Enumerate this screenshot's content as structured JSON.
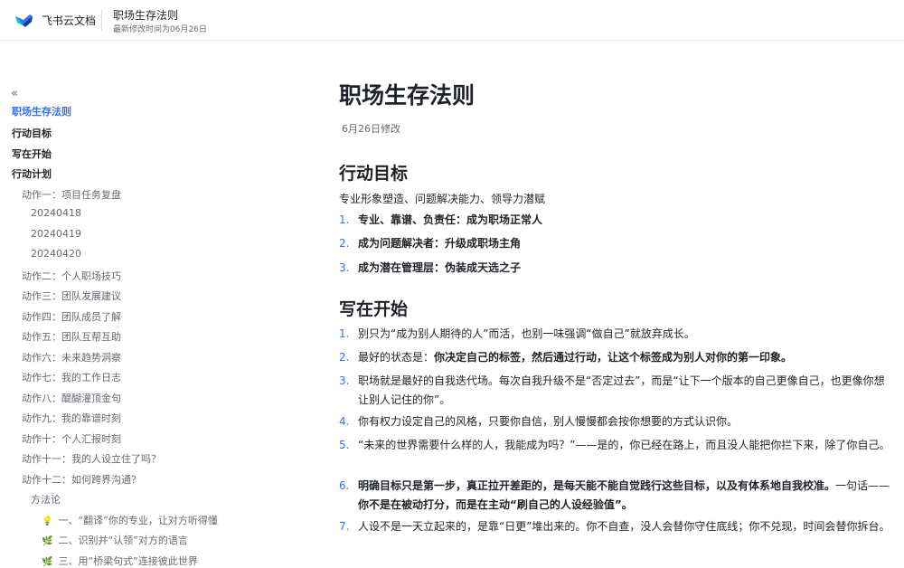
{
  "header": {
    "brand": "飞书云文档",
    "doc_title": "职场生存法则",
    "last_modified": "最新修改时间为06月26日"
  },
  "toc": {
    "collapse_icon": "«",
    "items": [
      {
        "label": "职场生存法则"
      },
      {
        "label": "行动目标"
      },
      {
        "label": "写在开始"
      },
      {
        "label": "行动计划"
      },
      {
        "label": "动作一：项目任务复盘"
      },
      {
        "label": "20240418"
      },
      {
        "label": "20240419"
      },
      {
        "label": "20240420"
      },
      {
        "label": "动作二：个人职场技巧"
      },
      {
        "label": "动作三：团队发展建议"
      },
      {
        "label": "动作四：团队成员了解"
      },
      {
        "label": "动作五：团队互帮互助"
      },
      {
        "label": "动作六：未来趋势洞察"
      },
      {
        "label": "动作七：我的工作日志"
      },
      {
        "label": "动作八：醍醐灌顶金句"
      },
      {
        "label": "动作九：我的靠谱时刻"
      },
      {
        "label": "动作十：个人汇报时刻"
      },
      {
        "label": "动作十一：我的人设立住了吗？"
      },
      {
        "label": "动作十二：如何跨界沟通？"
      },
      {
        "label": "方法论"
      },
      {
        "label": "一、“翻译”你的专业，让对方听得懂",
        "emoji": "💡"
      },
      {
        "label": "二、识别并“认领”对方的语言",
        "emoji": "🌿"
      },
      {
        "label": "三、用“桥梁句式”连接彼此世界",
        "emoji": "🌿"
      }
    ]
  },
  "doc": {
    "title": "职场生存法则",
    "modified": "6月26日修改",
    "sections": [
      {
        "heading": "行动目标",
        "intro": "专业形象塑造、问题解决能力、领导力潜赋",
        "items": [
          {
            "num": "1.",
            "bold": "专业、靠谱、负责任：成为职场正常人"
          },
          {
            "num": "2.",
            "bold": "成为问题解决者：升级成职场主角"
          },
          {
            "num": "3.",
            "bold": "成为潜在管理层：伪装成天选之子"
          }
        ]
      },
      {
        "heading": "写在开始",
        "items": [
          {
            "num": "1.",
            "pre": "别只为“成为别人期待的人”而活，也别一味强调“做自己”就放弃成长。"
          },
          {
            "num": "2.",
            "pre": "最好的状态是：",
            "bold": "你决定自己的标签，然后通过行动，让这个标签成为别人对你的第一印象。"
          },
          {
            "num": "3.",
            "pre": "职场就是最好的自我迭代场。每次自我升级不是“否定过去”，而是“让下一个版本的自己更像自己，也更像你想让别人记住的你”。"
          },
          {
            "num": "4.",
            "pre": "你有权力设定自己的风格，只要你自信，别人慢慢都会按你想要的方式认识你。"
          },
          {
            "num": "5.",
            "pre": "“未来的世界需要什么样的人，我能成为吗？”——是的，你已经在路上，而且没人能把你拦下来，除了你自己。"
          },
          {
            "num": "6.",
            "bold": "明确目标只是第一步，真正拉开差距的，是每天能不能自觉践行这些目标，以及有体系地自我校准。",
            "mid": "一句话——",
            "bold2": "你不是在被动打分，而是在主动“刷自己的人设经验值”。"
          },
          {
            "num": "7.",
            "pre": "人设不是一天立起来的，是靠“日更”堆出来的。你不自查，没人会替你守住底线；你不兑现，时间会替你拆台。"
          }
        ]
      }
    ]
  },
  "colors": {
    "accent": "#3370ff",
    "text": "#1f2329",
    "muted": "#646a73"
  },
  "icons": {
    "logo": "feishu-docs-logo-icon",
    "collapse": "double-chevron-left-icon"
  }
}
